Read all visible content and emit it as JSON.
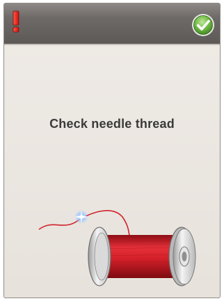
{
  "dialog": {
    "message": "Check needle thread",
    "icons": {
      "warning": "exclamation-icon",
      "ok": "checkmark-icon",
      "illustration": "thread-spool-icon"
    },
    "colors": {
      "title_bar": "#6e6a68",
      "warning": "#e02020",
      "ok": "#5aa33a",
      "thread": "#d0212a",
      "background": "#ebe7e2"
    }
  }
}
